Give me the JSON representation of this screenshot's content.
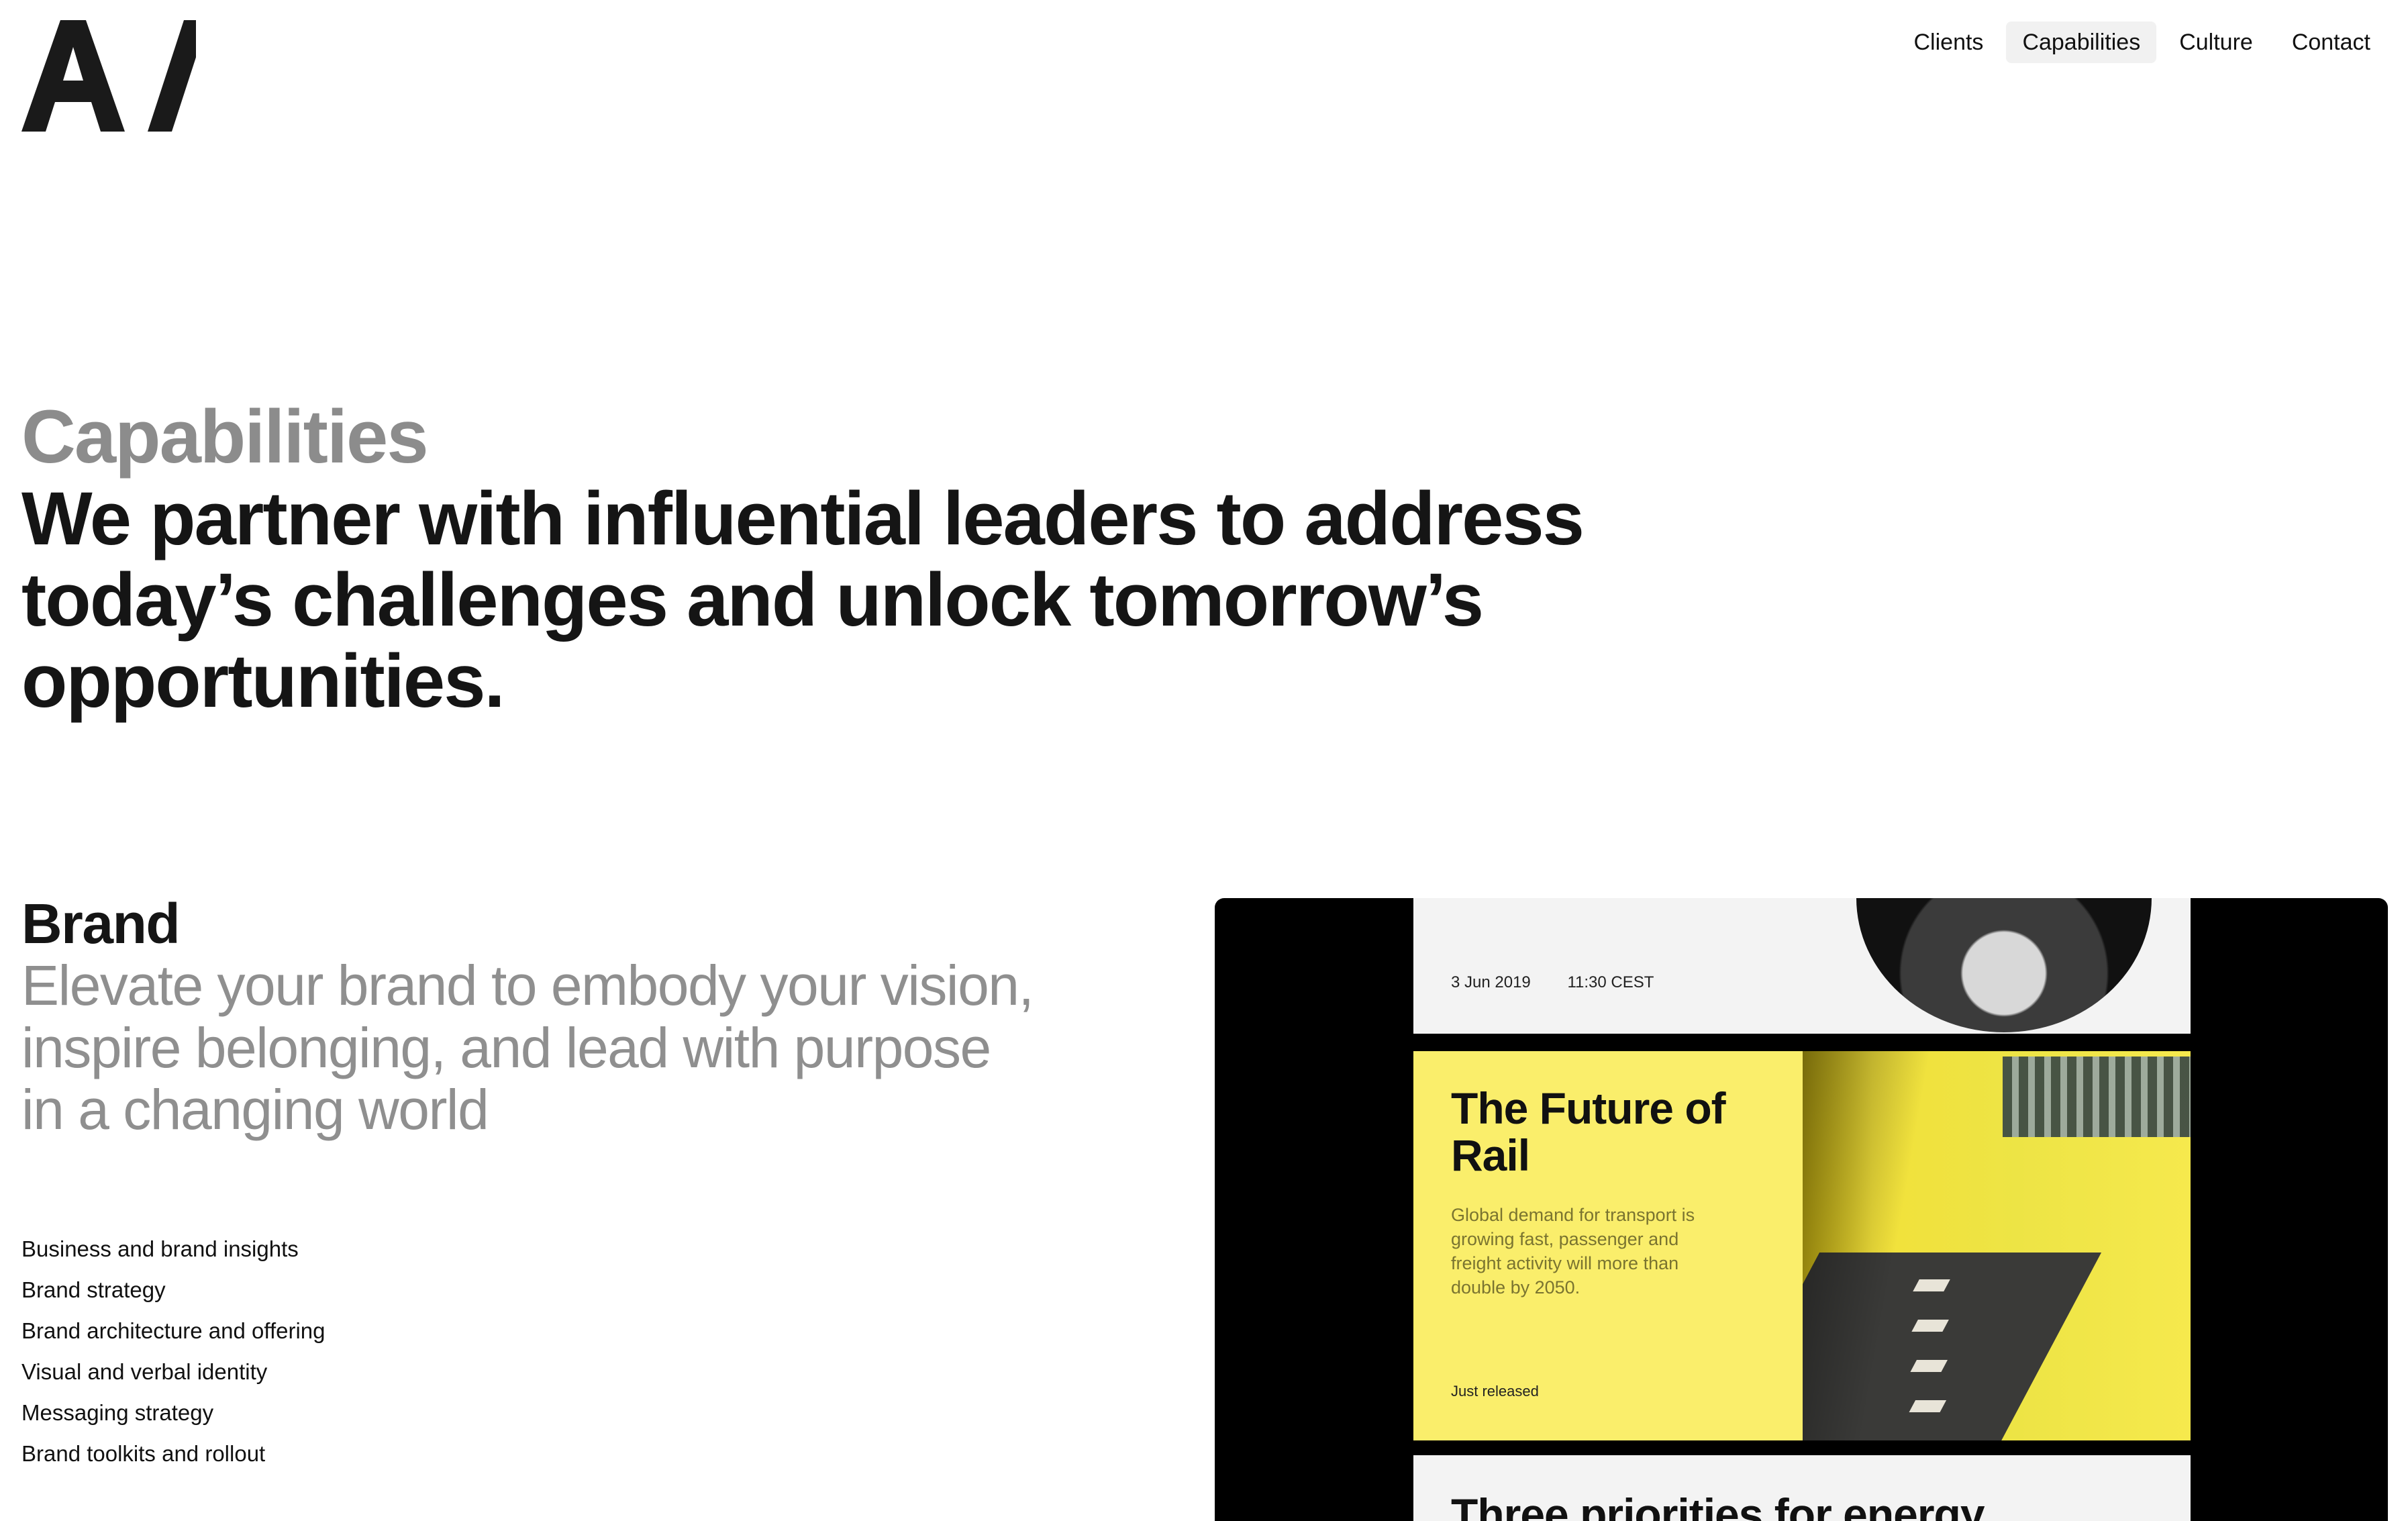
{
  "header": {
    "logo_alt": "A/",
    "nav": [
      {
        "label": "Clients",
        "active": false
      },
      {
        "label": "Capabilities",
        "active": true
      },
      {
        "label": "Culture",
        "active": false
      },
      {
        "label": "Contact",
        "active": false
      }
    ]
  },
  "hero": {
    "label": "Capabilities",
    "statement": "We partner with influential leaders to address today’s challenges and unlock tomorrow’s opportunities."
  },
  "brand_section": {
    "title": "Brand",
    "subtitle": "Elevate your brand to embody your vision, inspire belonging, and lead with purpose in a changing world",
    "items": [
      "Business and brand insights",
      "Brand strategy",
      "Brand architecture and offering",
      "Visual and verbal identity",
      "Messaging strategy",
      "Brand toolkits and rollout"
    ]
  },
  "feature": {
    "date": "3 Jun 2019",
    "time": "11:30 CEST",
    "title": "The Future of Rail",
    "body": "Global demand for transport is growing fast, passenger and freight activity will more than double by 2050.",
    "status": "Just released",
    "next_title": "Three priorities for energy"
  },
  "colors": {
    "accent_yellow": "#faee6b",
    "muted_text": "#8c8c8c",
    "text": "#151515",
    "nav_active_bg": "#f1f1f1"
  }
}
